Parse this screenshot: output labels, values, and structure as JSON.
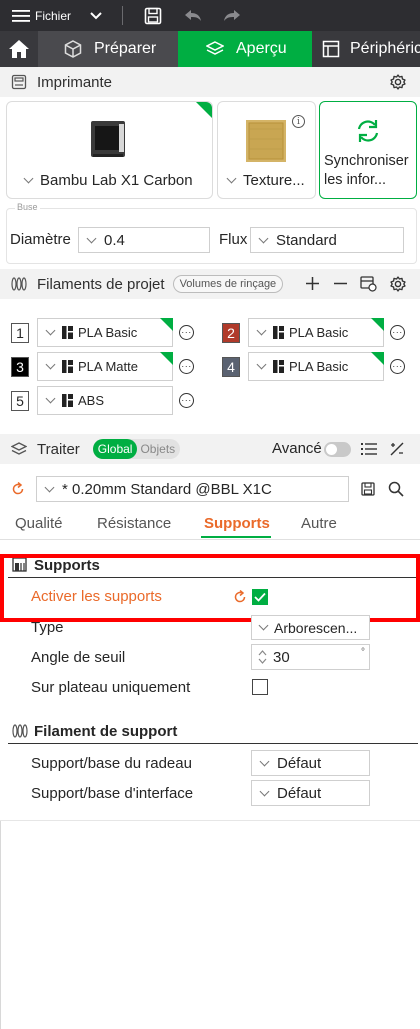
{
  "topbar": {
    "menu_label": "Fichier"
  },
  "tabs": [
    {
      "label": "Préparer"
    },
    {
      "label": "Aperçu"
    },
    {
      "label": "Périphéric"
    }
  ],
  "printer_section": {
    "title": "Imprimante"
  },
  "printer": {
    "name": "Bambu Lab X1 Carbon",
    "plate": "Texture...",
    "sync_label": "Synchroniser les infor..."
  },
  "nozzle": {
    "group_label": "Buse",
    "diameter_label": "Diamètre",
    "diameter_value": "0.4",
    "flow_label": "Flux",
    "flow_value": "Standard"
  },
  "filaments_section": {
    "title": "Filaments de projet",
    "rinse_button": "Volumes de rinçage"
  },
  "filaments": [
    {
      "num": "1",
      "name": "PLA Basic",
      "color": "#ffffff",
      "text_color": "#262626"
    },
    {
      "num": "2",
      "name": "PLA Basic",
      "color": "#b03a2a",
      "text_color": "#ffffff"
    },
    {
      "num": "3",
      "name": "PLA Matte",
      "color": "#000000",
      "text_color": "#ffffff"
    },
    {
      "num": "4",
      "name": "PLA Basic",
      "color": "#5a6271",
      "text_color": "#ffffff"
    },
    {
      "num": "5",
      "name": "ABS",
      "color": "#ffffff",
      "text_color": "#262626"
    }
  ],
  "process_section": {
    "title": "Traiter",
    "toggle_global": "Global",
    "toggle_objects": "Objets",
    "advanced_label": "Avancé"
  },
  "preset": {
    "value": "* 0.20mm Standard @BBL X1C"
  },
  "subtabs": [
    {
      "label": "Qualité"
    },
    {
      "label": "Résistance"
    },
    {
      "label": "Supports"
    },
    {
      "label": "Autre"
    }
  ],
  "supports_group": {
    "title": "Supports",
    "enable_label": "Activer les supports",
    "type_label": "Type",
    "type_value": "Arborescen...",
    "angle_label": "Angle de seuil",
    "angle_value": "30",
    "angle_unit": "°",
    "plate_only_label": "Sur plateau uniquement"
  },
  "support_filament_group": {
    "title": "Filament de support",
    "raft_label": "Support/base du radeau",
    "raft_value": "Défaut",
    "interface_label": "Support/base d'interface",
    "interface_value": "Défaut"
  },
  "colors": {
    "accent_green": "#00ae42",
    "accent_orange": "#ea6a2a",
    "highlight_red": "#ff0000"
  }
}
